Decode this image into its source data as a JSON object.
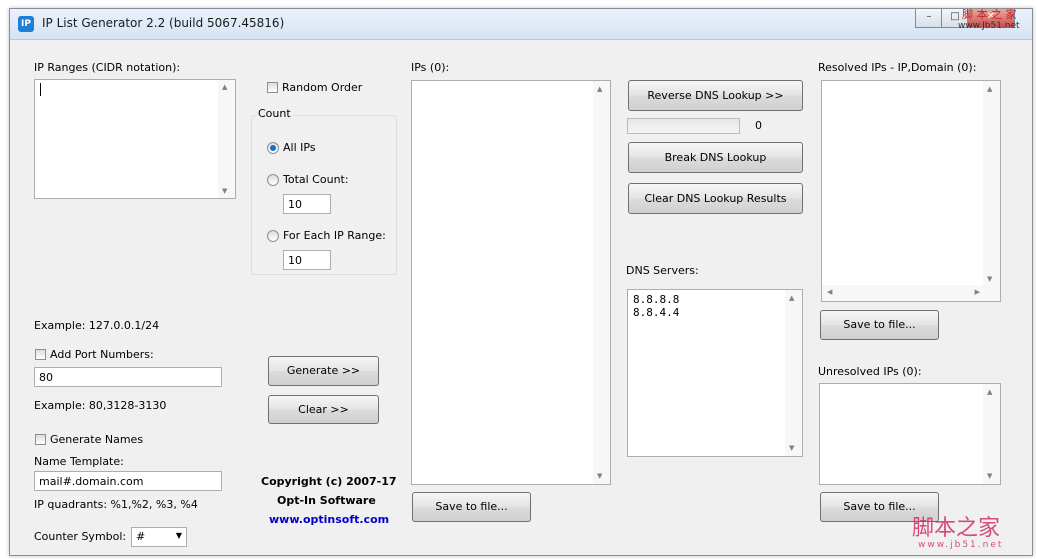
{
  "window": {
    "title": "IP List Generator 2.2 (build 5067.45816)",
    "icon_text": "IP",
    "controls": [
      "minimize-icon",
      "maximize-icon",
      "close-icon"
    ]
  },
  "watermark": {
    "top": "脚 本 之 家",
    "top_url": "www.Jb51.net",
    "bottom": "脚本之家",
    "bottom_url": "www.jb51.net"
  },
  "left": {
    "ip_ranges_label": "IP Ranges (CIDR notation):",
    "ip_ranges_value": "",
    "example_cidr": "Example: 127.0.0.1/24",
    "add_port_label": "Add Port Numbers:",
    "port_value": "80",
    "example_ports": "Example: 80,3128-3130",
    "generate_names_label": "Generate Names",
    "name_template_label": "Name Template:",
    "name_template_value": "mail#.domain.com",
    "ip_quadrants": "IP quadrants: %1,%2, %3, %4",
    "counter_symbol_label": "Counter Symbol:",
    "counter_symbol_value": "#"
  },
  "options": {
    "random_order_label": "Random Order",
    "count_group_label": "Count",
    "all_ips_label": "All IPs",
    "total_count_label": "Total Count:",
    "total_count_value": "10",
    "each_range_label": "For Each IP Range:",
    "each_range_value": "10",
    "selected_count_mode": "All IPs"
  },
  "actions": {
    "generate_label": "Generate >>",
    "clear_label": "Clear >>"
  },
  "copyright": {
    "line1": "Copyright (c) 2007-17",
    "line2": "Opt-In Software",
    "link": "www.optinsoft.com"
  },
  "ips": {
    "label": "IPs (0):",
    "save_label": "Save to file..."
  },
  "dns": {
    "reverse_label": "Reverse DNS Lookup >>",
    "progress_value": "0",
    "break_label": "Break DNS Lookup",
    "clear_results_label": "Clear DNS Lookup Results",
    "servers_label": "DNS Servers:",
    "servers": [
      "8.8.8.8",
      "8.8.4.4"
    ]
  },
  "resolved": {
    "label": "Resolved IPs - IP,Domain (0):",
    "save_label": "Save to file..."
  },
  "unresolved": {
    "label": "Unresolved IPs (0):",
    "save_label": "Save to file..."
  }
}
